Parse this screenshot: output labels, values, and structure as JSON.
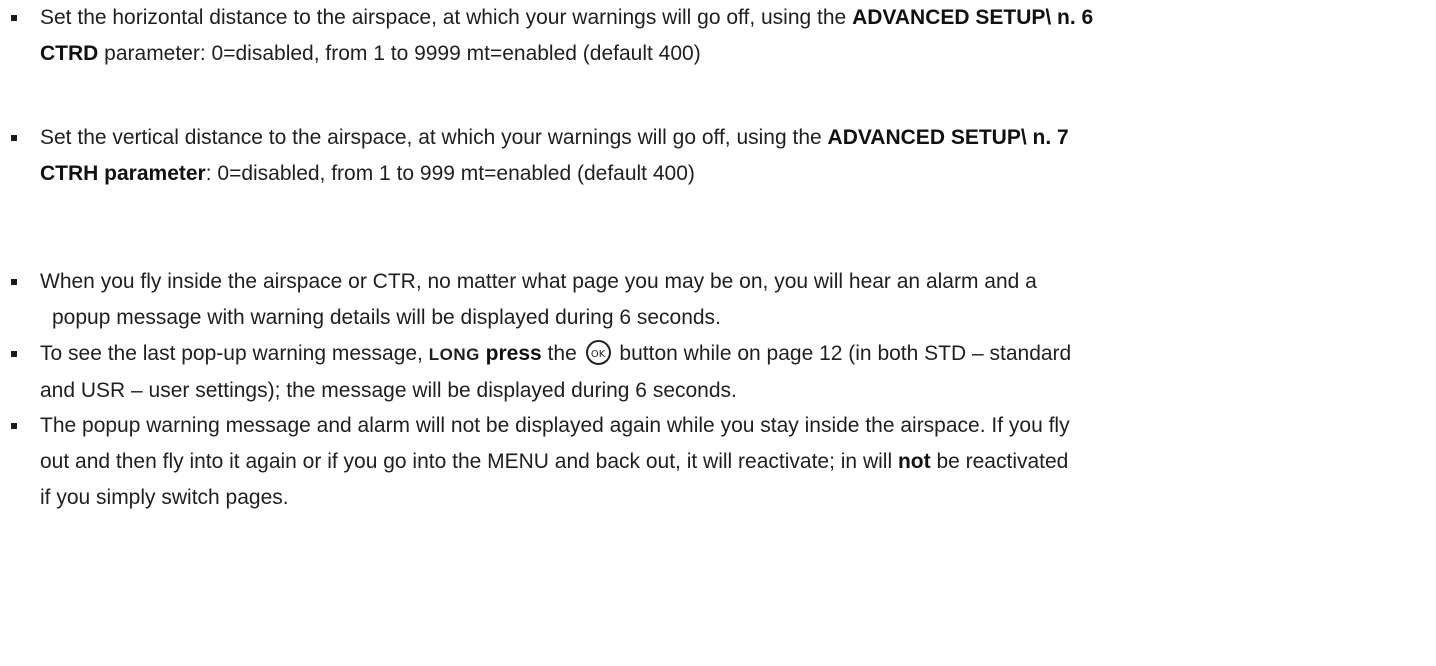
{
  "bullets": [
    {
      "l1_a": "Set the horizontal distance to the airspace, at which your warnings will go off, using the ",
      "l1_b": "ADVANCED SETUP\\ n. 6",
      "l2_a": "CTRD",
      "l2_b": " parameter:  0=disabled,  from 1 to 9999 mt=enabled  (default 400)"
    },
    {
      "l1_a": "Set the vertical distance to the airspace, at which your warnings will go off, using the ",
      "l1_b": "ADVANCED SETUP\\ n. 7",
      "l2_a": "CTRH parameter",
      "l2_b": ": 0=disabled, from 1 to 999 mt=enabled (default 400)"
    },
    {
      "l1": "When you fly inside the airspace or CTR, no matter what page you may be on, you will hear an alarm and a",
      "l2": "popup message with warning details will be displayed during 6 seconds."
    },
    {
      "l1_a": "To see the last pop-up warning message, ",
      "l1_long": "LONG",
      "l1_press": " press",
      "l1_the": " the ",
      "ok_icon_label": "OK",
      "l1_c": " button while on page 12 (in both STD – standard",
      "l2": "and USR – user settings); the message will be displayed during 6 seconds."
    },
    {
      "l1": "The popup warning message and alarm will not be displayed again while you stay inside the airspace. If you fly",
      "l2_a": "out and then fly into it again or if you go into the MENU and back out, it will reactivate; in will ",
      "l2_not": "not",
      "l2_b": " be reactivated",
      "l3": "if you simply switch pages."
    }
  ]
}
